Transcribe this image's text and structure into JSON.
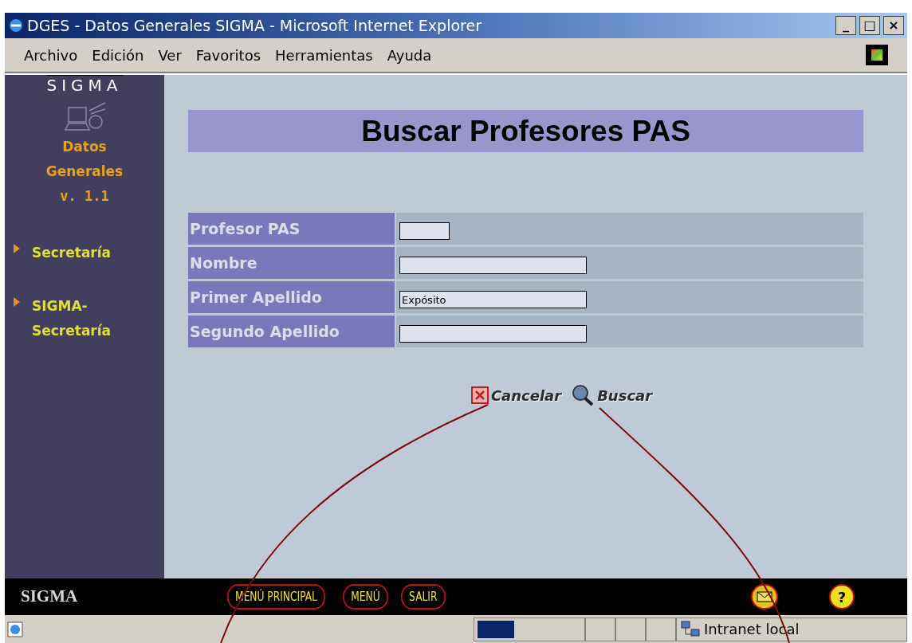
{
  "window": {
    "title": "DGES - Datos Generales SIGMA - Microsoft Internet Explorer",
    "controls": [
      "_",
      "□",
      "×"
    ]
  },
  "menu": [
    "Archivo",
    "Edición",
    "Ver",
    "Favoritos",
    "Herramientas",
    "Ayuda"
  ],
  "sidebar": {
    "logo": "SIGMA",
    "app_name": [
      "Datos",
      "Generales"
    ],
    "version": "v. 1.1",
    "items": [
      {
        "label": "Secretaría"
      },
      {
        "label": "SIGMA-\nSecretaría"
      }
    ]
  },
  "header": "Buscar Profesores PAS",
  "form": [
    {
      "label": "Profesor PAS",
      "kind": "short"
    },
    {
      "label": "Nombre",
      "kind": "long"
    },
    {
      "label": "Primer Apellido",
      "kind": "long",
      "value": "Expósito"
    },
    {
      "label": "Segundo Apellido",
      "kind": "long"
    }
  ],
  "actions": [
    {
      "kind": "cancel",
      "label": "Cancelar"
    },
    {
      "kind": "search",
      "label": "Buscar"
    }
  ],
  "footer": {
    "brand": "SIGMA",
    "buttons": [
      "MENÚ PRINCIPAL",
      "MENÚ",
      "SALIR"
    ],
    "help": "?"
  },
  "status_bar": {
    "progress": {
      "level": 0.35
    },
    "zone": "Intranet local"
  }
}
